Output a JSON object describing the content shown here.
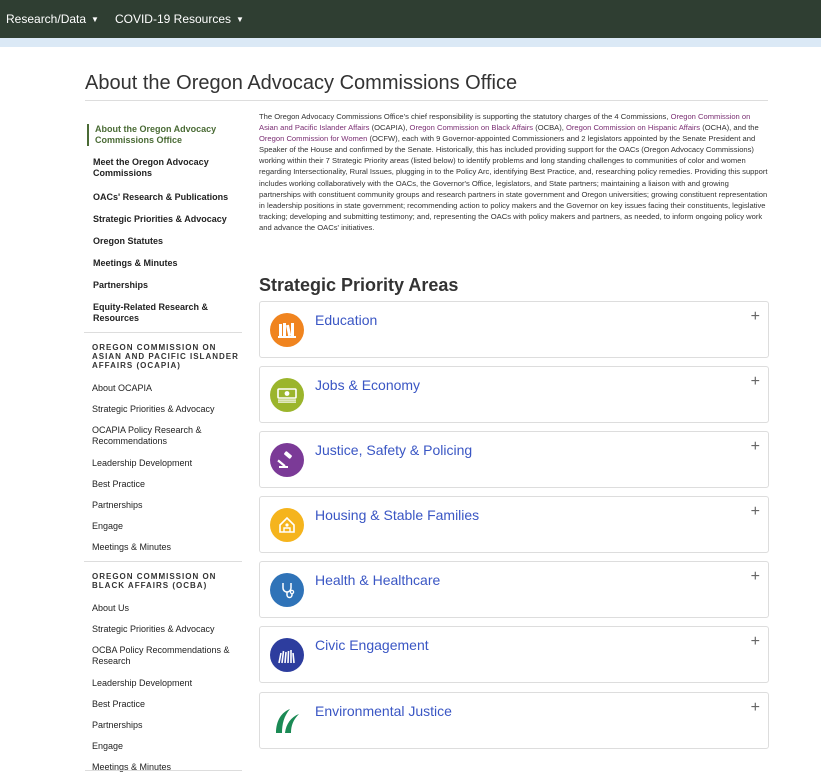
{
  "topnav": {
    "items": [
      {
        "label": "Research/Data"
      },
      {
        "label": "COVID-19 Resources"
      }
    ]
  },
  "page": {
    "title": "About the Oregon Advocacy Commissions Office"
  },
  "sidebar": {
    "main_items": [
      {
        "label": "About the Oregon Advocacy Commissions Office"
      },
      {
        "label": "Meet the Oregon Advocacy Commissions"
      },
      {
        "label": "OACs' Research & Publications"
      },
      {
        "label": "Strategic Priorities & Advocacy"
      },
      {
        "label": "Oregon Statutes"
      },
      {
        "label": "Meetings & Minutes"
      },
      {
        "label": "Partnerships"
      },
      {
        "label": "Equity-Related Research & Resources"
      }
    ],
    "ocapia": {
      "heading": "OREGON COMMISSION ON ASIAN AND PACIFIC ISLANDER AFFAIRS (OCAPIA)",
      "items": [
        {
          "label": "About OCAPIA"
        },
        {
          "label": "Strategic Priorities & Advocacy"
        },
        {
          "label": "OCAPIA Policy Research & Recommendations"
        },
        {
          "label": "Leadership Development"
        },
        {
          "label": "Best Practice"
        },
        {
          "label": "Partnerships"
        },
        {
          "label": "Engage"
        },
        {
          "label": "Meetings & Minutes"
        }
      ]
    },
    "ocba": {
      "heading": "OREGON COMMISSION ON BLACK AFFAIRS (OCBA)",
      "items": [
        {
          "label": "About Us"
        },
        {
          "label": "Strategic Priorities & Advocacy"
        },
        {
          "label": "OCBA Policy Recommendations & Research"
        },
        {
          "label": "Leadership Development"
        },
        {
          "label": "Best Practice"
        },
        {
          "label": "Partnerships"
        },
        {
          "label": "Engage"
        },
        {
          "label": "Meetings & Minutes"
        }
      ]
    }
  },
  "intro": {
    "p1": "The Oregon Advocacy Commissions Office's chief responsibility is supporting the statutory charges of the 4 Commissions, ",
    "l1": "Oregon Commission on Asian and Pacific Islander Affairs",
    "p2": " (OCAPIA), ",
    "l2": "Oregon Commission on Black Affairs",
    "p3": " (OCBA), ",
    "l3": "Oregon Commission on Hispanic Affairs",
    "p4": " (OCHA), and the ",
    "l4": "Oregon Commission for Women",
    "p5": " (OCFW), each with 9 Governor-appointed Commissioners and 2 legislators appointed by the Senate President and Speaker of the House and confirmed by the Senate.  Historically, this has included providing support for the OACs (Oregon Advocacy Commissions) working within their 7 Strategic Priority areas (listed below) to identify problems and long standing challenges to communities of color and women regarding Intersectionality, Rural Issues, plugging in to the Policy Arc, identifying Best Practice, and, researching policy remedies.  Providing this support includes working collaboratively with the OACs, the Governor's Office, legislators, and State partners; maintaining a liaison with and growing partnerships with constituent community groups and research partners in state government and Oregon universities; growing constituent representation in leadership positions in state government; recommending action to policy makers and the Governor on key issues facing their constituents, legislative tracking; developing and submitting testimony; and, representing the OACs with policy makers and partners, as needed, to inform ongoing policy work and advance the OACs' initiatives."
  },
  "priorities": {
    "title": "Strategic Priority Areas",
    "items": [
      {
        "label": "Education",
        "icon": "books-icon",
        "color": "#f0841f"
      },
      {
        "label": "Jobs & Economy",
        "icon": "money-icon",
        "color": "#9bb52c"
      },
      {
        "label": "Justice, Safety & Policing",
        "icon": "gavel-icon",
        "color": "#7b3a97"
      },
      {
        "label": "Housing & Stable Families",
        "icon": "house-icon",
        "color": "#f5b41d"
      },
      {
        "label": "Health & Healthcare",
        "icon": "stethoscope-icon",
        "color": "#2f73b8"
      },
      {
        "label": "Civic Engagement",
        "icon": "raised-hands-icon",
        "color": "#2d3d9e"
      },
      {
        "label": "Environmental Justice",
        "icon": "leaf-icon",
        "color": "#1b8a55"
      }
    ],
    "expand_symbol": "+"
  }
}
